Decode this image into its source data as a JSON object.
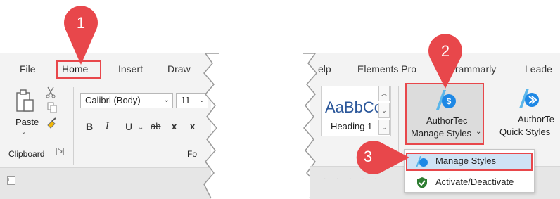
{
  "left": {
    "tabs": [
      "File",
      "Home",
      "Insert",
      "Draw"
    ],
    "clipboard": {
      "paste": "Paste",
      "group_label": "Clipboard"
    },
    "font": {
      "name": "Calibri (Body)",
      "size": "11",
      "group_label_partial": "Fo"
    },
    "format_buttons": [
      "B",
      "I",
      "U",
      "ab",
      "x",
      "x"
    ]
  },
  "right": {
    "tabs": [
      "elp",
      "Elements Pro",
      "Grammarly",
      "Leade"
    ],
    "style_gallery": {
      "preview": "AaBbCc",
      "name": "Heading 1"
    },
    "authortec_button": {
      "line1": "AuthorTec",
      "line2": "Manage Styles"
    },
    "quick_button": {
      "line1": "AuthorTe",
      "line2": "Quick Styles"
    },
    "menu": {
      "items": [
        {
          "label": "Manage Styles",
          "icon": "authortec-icon",
          "highlighted": true
        },
        {
          "label": "Activate/Deactivate",
          "icon": "shield-check-icon",
          "highlighted": false
        }
      ]
    }
  },
  "badges": [
    "1",
    "2",
    "3"
  ],
  "colors": {
    "accent": "#e8474b",
    "highlight": "#2b579a",
    "logo": "#1e88e5"
  }
}
